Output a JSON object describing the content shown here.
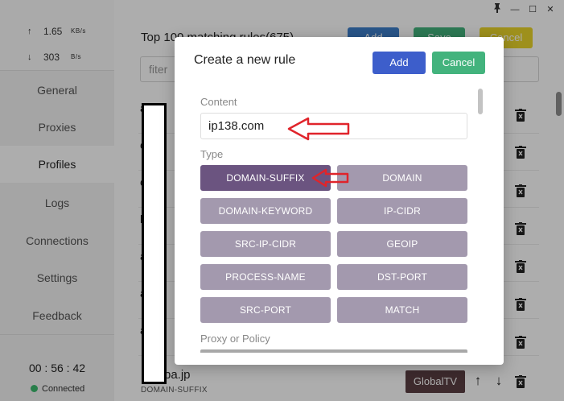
{
  "sidebar": {
    "upload": {
      "arrow": "↑",
      "value": "1.65",
      "unit": "KB/s"
    },
    "download": {
      "arrow": "↓",
      "value": "303",
      "unit": "B/s"
    },
    "items": [
      {
        "label": "General"
      },
      {
        "label": "Proxies"
      },
      {
        "label": "Profiles"
      },
      {
        "label": "Logs"
      },
      {
        "label": "Connections"
      },
      {
        "label": "Settings"
      },
      {
        "label": "Feedback"
      }
    ],
    "timer": "00 : 56 : 42",
    "status": "Connected"
  },
  "window": {
    "pin_glyph": "📌",
    "minimize_glyph": "—",
    "maximize_glyph": "☐",
    "close_glyph": "✕"
  },
  "main": {
    "title": "Top 100 matching rules(675)",
    "add_label": "Add",
    "save_label": "Save",
    "cancel_label": "Cancel",
    "filter_placeholder": "fiter",
    "rows": [
      {
        "prefix": "a"
      },
      {
        "prefix": "c"
      },
      {
        "prefix": "c"
      },
      {
        "prefix": "h"
      },
      {
        "prefix": "a"
      },
      {
        "prefix": "a"
      },
      {
        "prefix": "a"
      },
      {
        "prefix": "a"
      }
    ],
    "last_row": {
      "name": "pa.jp",
      "type": "DOMAIN-SUFFIX",
      "policy": "GlobalTV"
    },
    "up_glyph": "↑",
    "down_glyph": "↓"
  },
  "dialog": {
    "title": "Create a new rule",
    "add_label": "Add",
    "cancel_label": "Cancel",
    "content_label": "Content",
    "content_value": "ip138.com",
    "type_label": "Type",
    "types": [
      {
        "label": "DOMAIN-SUFFIX",
        "selected": true
      },
      {
        "label": "DOMAIN",
        "selected": false
      },
      {
        "label": "DOMAIN-KEYWORD",
        "selected": false
      },
      {
        "label": "IP-CIDR",
        "selected": false
      },
      {
        "label": "SRC-IP-CIDR",
        "selected": false
      },
      {
        "label": "GEOIP",
        "selected": false
      },
      {
        "label": "PROCESS-NAME",
        "selected": false
      },
      {
        "label": "DST-PORT",
        "selected": false
      },
      {
        "label": "SRC-PORT",
        "selected": false
      },
      {
        "label": "MATCH",
        "selected": false
      }
    ],
    "proxy_label": "Proxy or Policy"
  },
  "colors": {
    "add_blue": "#3d5ecb",
    "cancel_green": "#43b37d",
    "type_selected": "#6b5480",
    "type_normal": "#a399ae",
    "annotation_red": "#e0242b",
    "connected_green": "#3cba6e",
    "save_green": "#43b37d",
    "cancel_yellow": "#e9d52a"
  }
}
